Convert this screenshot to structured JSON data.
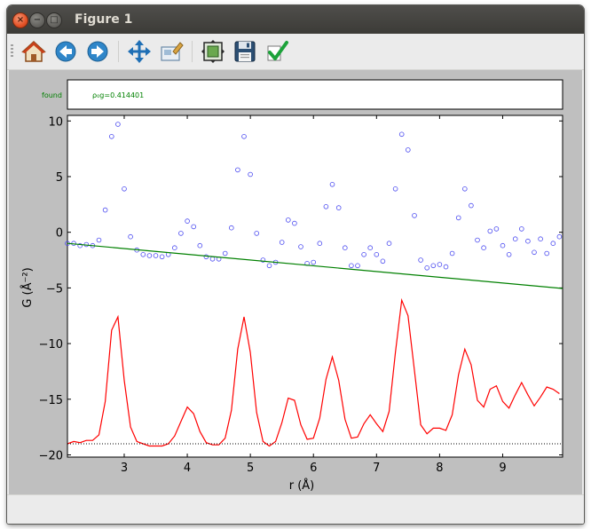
{
  "window": {
    "title": "Figure 1",
    "close_glyph": "×",
    "min_glyph": "−",
    "max_glyph": "□"
  },
  "toolbar": {
    "icons": [
      "home-icon",
      "back-arrow-icon",
      "forward-arrow-icon",
      "pan-move-icon",
      "zoom-to-rect-icon",
      "configure-subplots-icon",
      "save-floppy-icon",
      "apply-checkmark-icon"
    ]
  },
  "colors": {
    "observed": "#4a4af0",
    "baseline": "#008000",
    "difference": "#ff0000",
    "annotation": "#008000"
  },
  "chart_data": [
    {
      "type": "text-panel",
      "labels": [
        "found",
        "ρ₀g=0.414401"
      ]
    },
    {
      "type": "line",
      "xlabel": "r (Å)",
      "ylabel": "G (Å⁻²)",
      "xlim": [
        2.1,
        9.95
      ],
      "ylim": [
        -20.2,
        10.5
      ],
      "xticks": [
        3,
        4,
        5,
        6,
        7,
        8,
        9
      ],
      "yticks": [
        10,
        5,
        0,
        -5,
        -10,
        -15,
        -20
      ],
      "grid": false,
      "x": [
        2.1,
        2.2,
        2.3,
        2.4,
        2.5,
        2.6,
        2.7,
        2.8,
        2.9,
        3.0,
        3.1,
        3.2,
        3.3,
        3.4,
        3.5,
        3.6,
        3.7,
        3.8,
        3.9,
        4.0,
        4.1,
        4.2,
        4.3,
        4.4,
        4.5,
        4.6,
        4.7,
        4.8,
        4.9,
        5.0,
        5.1,
        5.2,
        5.3,
        5.4,
        5.5,
        5.6,
        5.7,
        5.8,
        5.9,
        6.0,
        6.1,
        6.2,
        6.3,
        6.4,
        6.5,
        6.6,
        6.7,
        6.8,
        6.9,
        7.0,
        7.1,
        7.2,
        7.3,
        7.4,
        7.5,
        7.6,
        7.7,
        7.8,
        7.9,
        8.0,
        8.1,
        8.2,
        8.3,
        8.4,
        8.5,
        8.6,
        8.7,
        8.8,
        8.9,
        9.0,
        9.1,
        9.2,
        9.3,
        9.4,
        9.5,
        9.6,
        9.7,
        9.8,
        9.9
      ],
      "series": [
        {
          "style": "circles",
          "color": "#4a4af0",
          "values": [
            -1.0,
            -1.0,
            -1.2,
            -1.1,
            -1.2,
            -0.7,
            2.0,
            8.6,
            9.7,
            3.9,
            -0.4,
            -1.6,
            -2.0,
            -2.1,
            -2.1,
            -2.2,
            -2.0,
            -1.4,
            -0.1,
            1.0,
            0.5,
            -1.2,
            -2.2,
            -2.4,
            -2.4,
            -1.9,
            0.4,
            5.6,
            8.6,
            5.2,
            -0.1,
            -2.5,
            -3.0,
            -2.7,
            -0.9,
            1.1,
            0.8,
            -1.3,
            -2.8,
            -2.7,
            -1.0,
            2.3,
            4.3,
            2.2,
            -1.4,
            -3.0,
            -3.0,
            -2.0,
            -1.4,
            -2.0,
            -2.6,
            -1.0,
            3.9,
            8.8,
            7.4,
            1.5,
            -2.5,
            -3.2,
            -3.0,
            -2.9,
            -3.1,
            -1.9,
            1.3,
            3.9,
            2.4,
            -0.7,
            -1.4,
            0.1,
            0.3,
            -1.2,
            -2.0,
            -0.6,
            0.3,
            -0.8,
            -1.8,
            -0.6,
            -1.9,
            -1.0,
            -0.4
          ]
        },
        {
          "style": "line",
          "color": "#008000",
          "x": [
            2.1,
            9.95
          ],
          "values": [
            -1.0,
            -5.05
          ]
        },
        {
          "style": "line",
          "color": "#ff0000",
          "values": [
            -19.0,
            -18.8,
            -18.9,
            -18.7,
            -18.7,
            -18.2,
            -15.2,
            -8.8,
            -7.6,
            -13.3,
            -17.5,
            -18.8,
            -19.0,
            -19.2,
            -19.2,
            -19.2,
            -19.0,
            -18.3,
            -17.0,
            -15.7,
            -16.3,
            -17.9,
            -18.9,
            -19.1,
            -19.1,
            -18.5,
            -16.0,
            -10.5,
            -7.6,
            -10.8,
            -16.2,
            -18.8,
            -19.2,
            -18.8,
            -17.1,
            -14.9,
            -15.1,
            -17.3,
            -18.6,
            -18.5,
            -16.7,
            -13.2,
            -11.2,
            -13.3,
            -16.8,
            -18.5,
            -18.4,
            -17.2,
            -16.4,
            -17.2,
            -17.9,
            -16.1,
            -10.8,
            -6.1,
            -7.5,
            -12.4,
            -17.3,
            -18.1,
            -17.6,
            -17.6,
            -17.8,
            -16.4,
            -12.8,
            -10.5,
            -11.9,
            -15.1,
            -15.7,
            -14.1,
            -13.8,
            -15.2,
            -15.8,
            -14.6,
            -13.5,
            -14.6,
            -15.6,
            -14.8,
            -13.9,
            -14.1,
            -14.5
          ]
        },
        {
          "style": "dotted",
          "color": "#000000",
          "x": [
            2.1,
            9.95
          ],
          "values": [
            -19.0,
            -19.0
          ]
        }
      ]
    }
  ]
}
